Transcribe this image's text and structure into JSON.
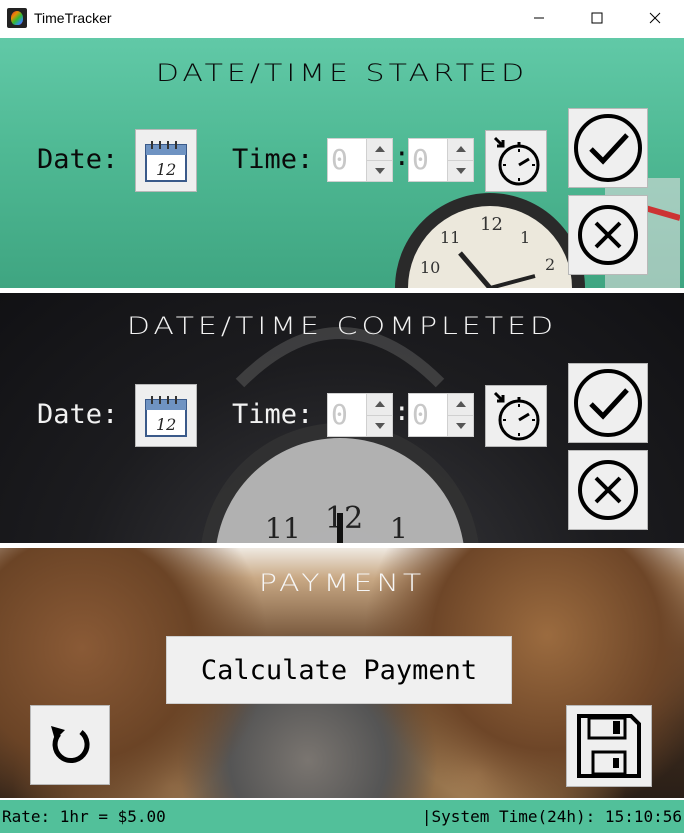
{
  "window": {
    "title": "TimeTracker"
  },
  "start_panel": {
    "title": "Date/Time Started",
    "date_label": "Date:",
    "time_label": "Time:",
    "hour_value": "0",
    "minute_value": "0",
    "colon": ":",
    "calendar_day": "12"
  },
  "end_panel": {
    "title": "Date/Time Completed",
    "date_label": "Date:",
    "time_label": "Time:",
    "hour_value": "0",
    "minute_value": "0",
    "colon": ":",
    "calendar_day": "12"
  },
  "payment_panel": {
    "title": "Payment",
    "calculate_label": "Calculate Payment"
  },
  "status": {
    "rate": "Rate: 1hr = $5.00",
    "system_time": "|System Time(24h): 15:10:56"
  },
  "colors": {
    "start_bg": "#4fb994",
    "end_bg": "#1c1c1f",
    "status_bg": "#52c09a"
  }
}
